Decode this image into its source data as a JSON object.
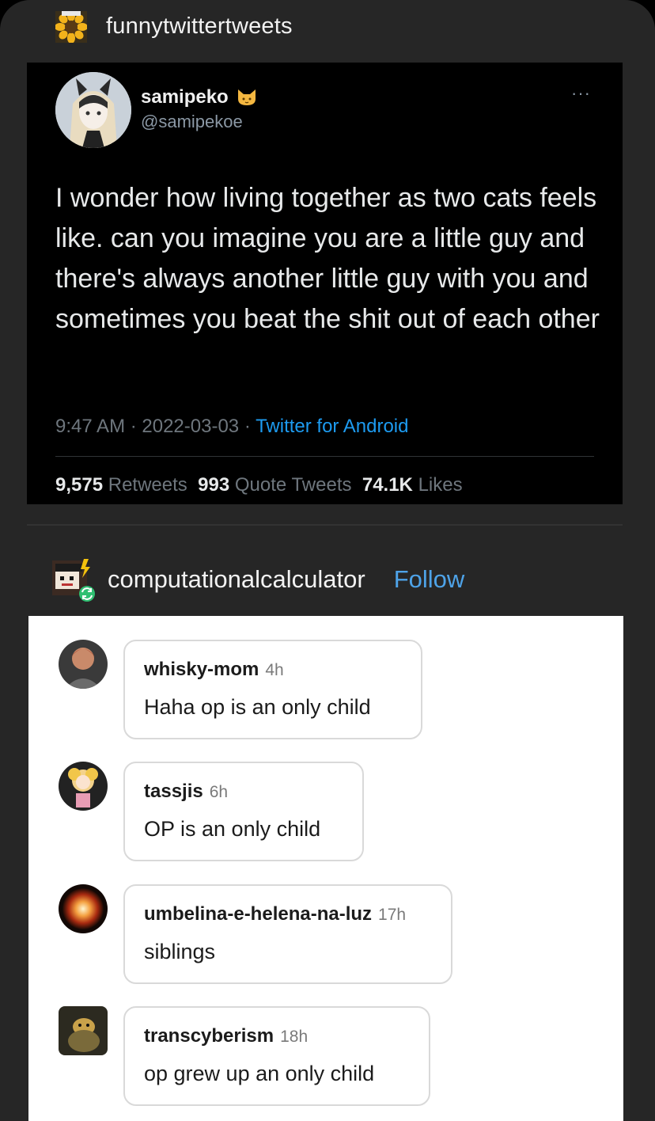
{
  "post": {
    "blog_name": "funnytwittertweets",
    "avatar_icon": "sunflower-icon"
  },
  "tweet": {
    "name": "samipeko",
    "badge_icon": "cat-emoji-icon",
    "handle": "@samipekoe",
    "more_label": "···",
    "text": "I wonder how living together as two cats feels like. can you imagine you are a little guy and there's always another little guy with you and sometimes you beat the shit out of each other",
    "time": "9:47 AM",
    "date": "2022-03-03",
    "source": "Twitter for Android",
    "sep": " · ",
    "stats": {
      "retweets_count": "9,575",
      "retweets_label": "Retweets",
      "quotes_count": "993",
      "quotes_label": "Quote Tweets",
      "likes_count": "74.1K",
      "likes_label": "Likes"
    },
    "colors": {
      "bg": "#000000",
      "link": "#1d9bf0",
      "muted": "#6e767d"
    }
  },
  "reblog": {
    "blog_name": "computationalcalculator",
    "follow_label": "Follow",
    "reblog_icon": "reblog-icon"
  },
  "notes": [
    {
      "username": "whisky-mom",
      "time": "4h",
      "text": "Haha op is an only child"
    },
    {
      "username": "tassjis",
      "time": "6h",
      "text": "OP is an only child"
    },
    {
      "username": "umbelina-e-helena-na-luz",
      "time": "17h",
      "text": "siblings"
    },
    {
      "username": "transcyberism",
      "time": "18h",
      "text": "op grew up an only child"
    }
  ]
}
